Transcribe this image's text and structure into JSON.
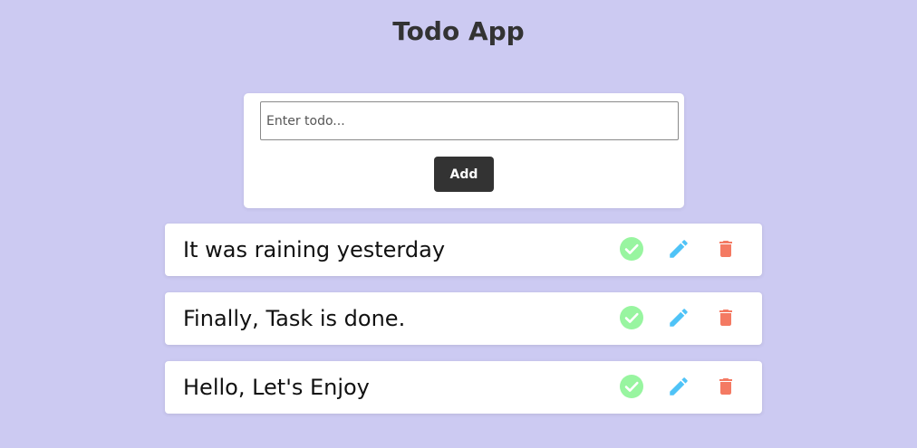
{
  "app": {
    "title": "Todo App"
  },
  "form": {
    "input_placeholder": "Enter todo...",
    "input_value": "",
    "add_label": "Add"
  },
  "todos": [
    {
      "text": "It was raining yesterday"
    },
    {
      "text": "Finally, Task is done."
    },
    {
      "text": "Hello, Let's Enjoy"
    }
  ],
  "icons": {
    "complete": "check-circle-icon",
    "edit": "pencil-icon",
    "delete": "trash-icon"
  },
  "colors": {
    "background": "#cccaf2",
    "complete": "#98f5a0",
    "edit": "#4fc3f7",
    "delete": "#f47a63",
    "button": "#333333"
  }
}
